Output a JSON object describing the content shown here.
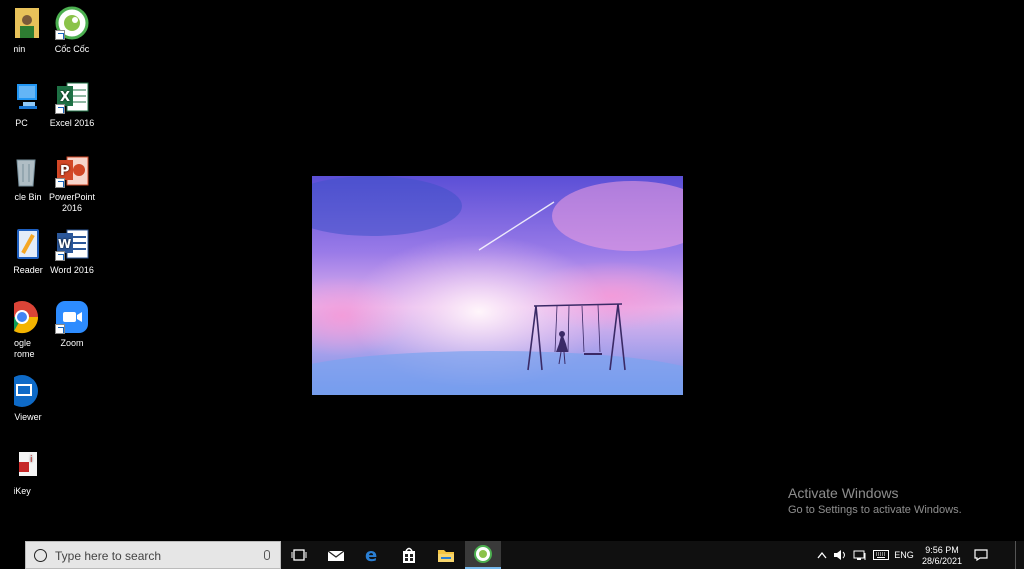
{
  "desktop": {
    "icons_left_column": [
      {
        "label": "min",
        "icon": "user-folder-icon"
      },
      {
        "label": "s PC",
        "icon": "this-pc-icon"
      },
      {
        "label": "cle Bin",
        "icon": "recycle-bin-icon"
      },
      {
        "label": "Reader",
        "icon": "foxit-reader-icon"
      },
      {
        "label": "ogle\nrome",
        "icon": "chrome-icon"
      },
      {
        "label": "Viewer",
        "icon": "teamviewer-icon"
      },
      {
        "label": "iKey",
        "icon": "unikey-icon"
      }
    ],
    "icons_right_column": [
      {
        "label": "Cốc Cốc",
        "icon": "coccoc-browser-icon"
      },
      {
        "label": "Excel 2016",
        "icon": "excel-icon"
      },
      {
        "label": "PowerPoint 2016",
        "icon": "powerpoint-icon"
      },
      {
        "label": "Word 2016",
        "icon": "word-icon"
      },
      {
        "label": "Zoom",
        "icon": "zoom-icon"
      }
    ]
  },
  "watermark": {
    "title": "Activate Windows",
    "subtitle": "Go to Settings to activate Windows."
  },
  "taskbar": {
    "search_placeholder": "Type here to search",
    "pinned": [
      {
        "name": "task-view-icon"
      },
      {
        "name": "mail-icon"
      },
      {
        "name": "edge-icon"
      },
      {
        "name": "store-icon"
      },
      {
        "name": "file-explorer-icon"
      },
      {
        "name": "coccoc-icon",
        "active": true
      }
    ],
    "tray": {
      "language": "ENG",
      "time": "9:56 PM",
      "date": "28/6/2021"
    }
  },
  "colors": {
    "taskbar_bg": "#101010",
    "accent": "#76b9ed",
    "excel": "#1e7145",
    "powerpoint": "#d24726",
    "word": "#2b579a",
    "zoom": "#2d8cff"
  }
}
